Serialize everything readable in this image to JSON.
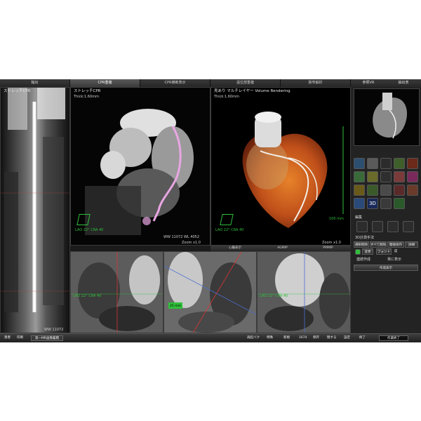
{
  "tabs": [
    "軸出",
    "CPR重複",
    "CPR横断表示",
    "遠位部重複",
    "狭窄解析"
  ],
  "right_tabs": [
    "参照VR",
    "抽出表"
  ],
  "panels": {
    "left_title": "ストレッチCPR",
    "cpr_title": "ストレッチCPR",
    "cpr_thick": "Thick:1.60mm",
    "cpr_orient": "LAO 22° CRA 40",
    "cpr_wl": "WW 11072  WL 4052",
    "cpr_zoom": "Zoom x1.0",
    "vr_title": "見あり マルチレイヤー Volume Rendering",
    "vr_thick": "Thick:1.60mm",
    "vr_orient": "LAO 22° CRA 40",
    "vr_scale": "100 mm",
    "vr_zoom": "Zoom x1.0",
    "left_wl": "WW 11072",
    "bottom_tab1": "心臓表示",
    "bottom_tab2": "AGMIP",
    "bottom_tab3": "PMMIP",
    "bottom_label1": "LAO 22° CRA 40",
    "bottom_label3": "LAO 22° CRA 40",
    "marker": "25 mm"
  },
  "sidebar": {
    "icon_label": "3D",
    "section1": "編集",
    "section2": "3D計測手法",
    "buttons": [
      "選択削除",
      "すべて削除",
      "閾値再作成",
      "詳細"
    ],
    "small_btns": [
      "変更",
      "フォント"
    ],
    "checks": [
      "連続作成",
      "常に表示"
    ],
    "wide_button": "作成表示"
  },
  "taskbar": {
    "items": [
      "患者",
      "印刷",
      "第一MR画像蓄積",
      "再起バク",
      "特殊",
      "新規",
      "1674",
      "保存",
      "閉する",
      "設定",
      "終了"
    ],
    "right_field": "作業終了"
  },
  "colors": {
    "accent_green": "#2fbf3a",
    "vessel_pink": "#e8a6e3",
    "heart_orange": "#d0621c"
  }
}
